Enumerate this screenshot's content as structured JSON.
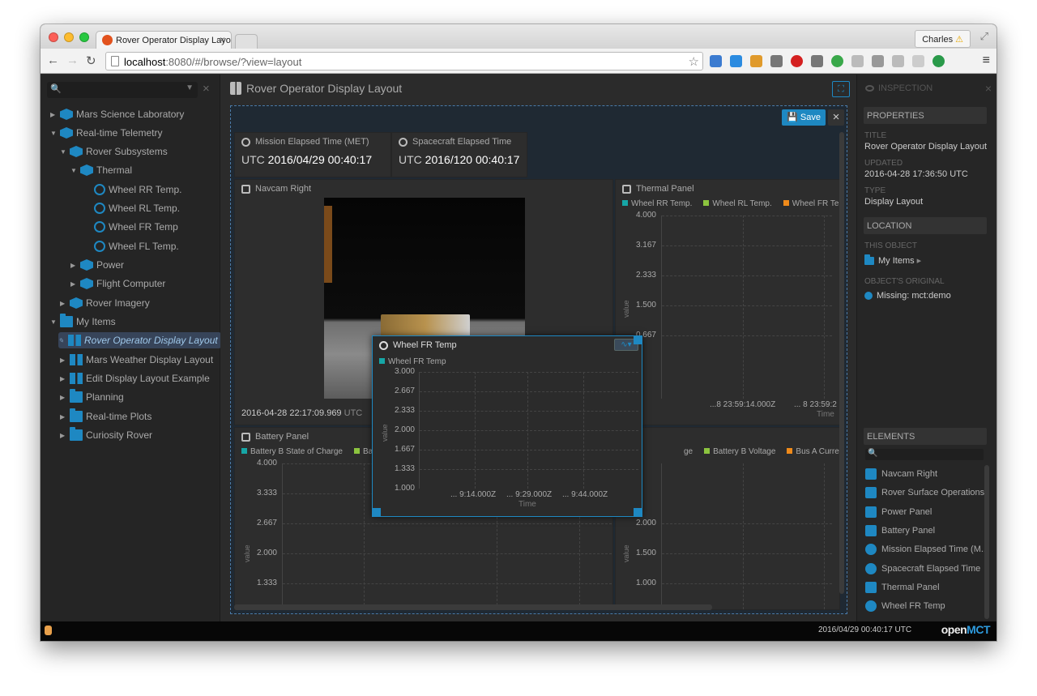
{
  "browser": {
    "tab_title": "Rover Operator Display Layout",
    "url_host": "localhost",
    "url_path": ":8080/#/browse/?view=layout",
    "profile": "Charles"
  },
  "tree": {
    "items": [
      {
        "label": "Mars Science Laboratory",
        "icon": "object-icon",
        "expanded": false
      },
      {
        "label": "Real-time Telemetry",
        "icon": "object-icon",
        "expanded": true
      },
      {
        "label": "Rover Subsystems",
        "icon": "object-icon",
        "expanded": true
      },
      {
        "label": "Thermal",
        "icon": "object-icon",
        "expanded": true
      },
      {
        "label": "Wheel RR Temp.",
        "icon": "telemetry-icon"
      },
      {
        "label": "Wheel RL Temp.",
        "icon": "telemetry-icon"
      },
      {
        "label": "Wheel FR Temp",
        "icon": "telemetry-icon"
      },
      {
        "label": "Wheel FL Temp.",
        "icon": "telemetry-icon"
      },
      {
        "label": "Power",
        "icon": "object-icon",
        "expanded": false
      },
      {
        "label": "Flight Computer",
        "icon": "object-icon",
        "expanded": false
      },
      {
        "label": "Rover Imagery",
        "icon": "object-icon",
        "expanded": false
      },
      {
        "label": "My Items",
        "icon": "folder-icon",
        "expanded": true
      },
      {
        "label": "Rover Operator Display Layout",
        "icon": "layout-icon",
        "selected": true
      },
      {
        "label": "Mars Weather Display Layout",
        "icon": "layout-icon"
      },
      {
        "label": "Edit Display Layout Example",
        "icon": "layout-icon"
      },
      {
        "label": "Planning",
        "icon": "folder-icon"
      },
      {
        "label": "Real-time Plots",
        "icon": "folder-icon"
      },
      {
        "label": "Curiosity Rover",
        "icon": "folder-icon"
      }
    ]
  },
  "main": {
    "title": "Rover Operator Display Layout",
    "save_label": "Save",
    "met": {
      "title": "Mission Elapsed Time (MET)",
      "prefix": "UTC",
      "value": "2016/04/29 00:40:17"
    },
    "set": {
      "title": "Spacecraft Elapsed Time",
      "prefix": "UTC",
      "value": "2016/120 00:40:17"
    },
    "navcam": {
      "title": "Navcam Right",
      "timestamp": "2016-04-28 22:17:09.969",
      "tz": "UTC"
    },
    "thermal": {
      "title": "Thermal Panel",
      "legend": [
        "Wheel RR Temp.",
        "Wheel RL Temp.",
        "Wheel FR Te"
      ],
      "yticks": [
        "4.000",
        "3.167",
        "2.333",
        "1.500",
        "0.667"
      ],
      "ylabel": "value",
      "xticks": [
        "...8 23:59:14.000Z",
        "... 8 23:59:2"
      ],
      "xlabel": "Time"
    },
    "battery": {
      "title": "Battery Panel",
      "legend": [
        "Battery B State of Charge",
        "Battery A State"
      ],
      "yticks": [
        "4.000",
        "3.333",
        "2.667",
        "2.000",
        "1.333"
      ],
      "ylabel": "value"
    },
    "power": {
      "legend": [
        "ge",
        "Battery B Voltage",
        "Bus A Curre"
      ],
      "yticks": [
        "2.000",
        "1.500",
        "1.000"
      ],
      "ylabel": "value"
    },
    "popup": {
      "title": "Wheel FR Temp",
      "legend": "Wheel FR Temp",
      "yticks": [
        "3.000",
        "2.667",
        "2.333",
        "2.000",
        "1.667",
        "1.333",
        "1.000"
      ],
      "ylabel": "value",
      "xticks": [
        "... 9:14.000Z",
        "... 9:29.000Z",
        "... 9:44.000Z"
      ],
      "xlabel": "Time"
    }
  },
  "inspector": {
    "header": "INSPECTION",
    "properties_label": "PROPERTIES",
    "title_key": "TITLE",
    "title_val": "Rover Operator Display Layout",
    "updated_key": "UPDATED",
    "updated_val": "2016-04-28 17:36:50 UTC",
    "type_key": "TYPE",
    "type_val": "Display Layout",
    "location_label": "LOCATION",
    "this_object_key": "THIS OBJECT",
    "this_object_val": "My Items",
    "original_key": "OBJECT'S ORIGINAL",
    "original_val": "Missing: mct:demo",
    "elements_label": "ELEMENTS",
    "elements": [
      "Navcam Right",
      "Rover Surface Operations",
      "Power Panel",
      "Battery Panel",
      "Mission Elapsed Time (M...",
      "Spacecraft Elapsed Time",
      "Thermal Panel",
      "Wheel FR Temp"
    ]
  },
  "status": {
    "utc": "2016/04/29 00:40:17 UTC",
    "logo_a": "open",
    "logo_b": "MCT"
  },
  "colors": {
    "accent": "#1e88c2",
    "series1": "#16a6a6",
    "series2": "#8cc43f",
    "series3": "#ef8a1a"
  }
}
